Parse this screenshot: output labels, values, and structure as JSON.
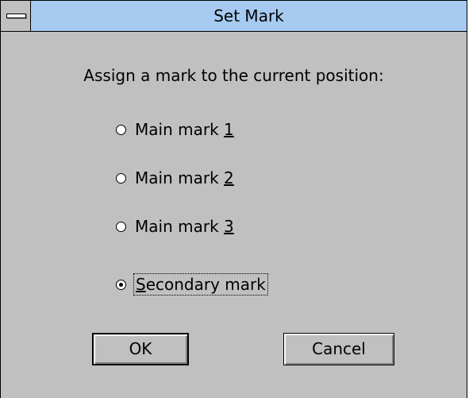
{
  "window": {
    "title": "Set Mark"
  },
  "prompt": "Assign a mark to the current position:",
  "options": [
    {
      "prefix": "Main mark ",
      "mnemonic": "1",
      "suffix": "",
      "selected": false
    },
    {
      "prefix": "Main mark ",
      "mnemonic": "2",
      "suffix": "",
      "selected": false
    },
    {
      "prefix": "Main mark ",
      "mnemonic": "3",
      "suffix": "",
      "selected": false
    },
    {
      "prefix": "",
      "mnemonic": "S",
      "suffix": "econdary mark",
      "selected": true
    }
  ],
  "buttons": {
    "ok_label": "OK",
    "cancel_label": "Cancel"
  },
  "colors": {
    "titlebar": "#a6caf0",
    "face": "#c0c0c0"
  }
}
